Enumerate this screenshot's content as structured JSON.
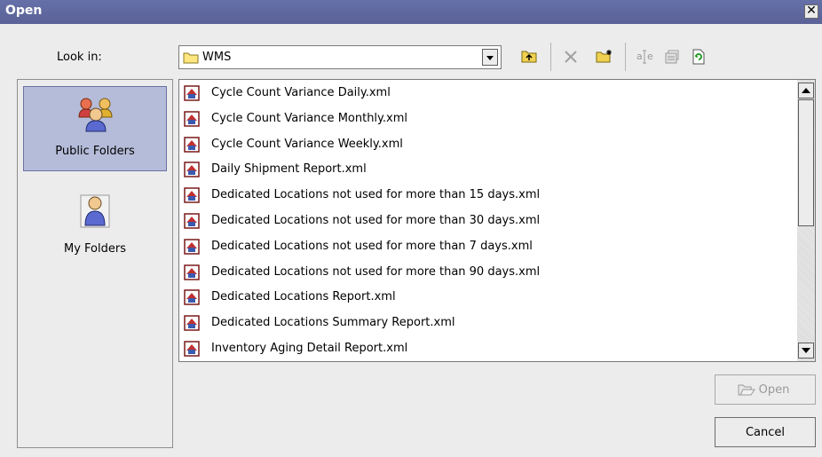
{
  "window": {
    "title": "Open"
  },
  "lookin": {
    "label": "Look in:",
    "value": "WMS"
  },
  "toolbar": {
    "icons": [
      "up-folder-icon",
      "delete-icon",
      "new-folder-icon",
      "rename-icon",
      "properties-icon",
      "refresh-icon"
    ]
  },
  "places": [
    {
      "label": "Public Folders",
      "selected": true
    },
    {
      "label": "My Folders",
      "selected": false
    }
  ],
  "files": [
    "Cycle Count Variance Daily.xml",
    "Cycle Count Variance Monthly.xml",
    "Cycle Count Variance Weekly.xml",
    "Daily Shipment Report.xml",
    "Dedicated Locations not used for more than 15 days.xml",
    "Dedicated Locations not used for more than 30 days.xml",
    "Dedicated Locations not used for more than 7 days.xml",
    "Dedicated Locations not used for more than 90 days.xml",
    "Dedicated Locations Report.xml",
    "Dedicated Locations Summary Report.xml",
    "Inventory Aging Detail Report.xml"
  ],
  "buttons": {
    "open_label": "Open",
    "cancel_label": "Cancel"
  },
  "colors": {
    "titlebar": "#5f67a0",
    "selection": "#b5bcd9",
    "background": "#ececec"
  }
}
